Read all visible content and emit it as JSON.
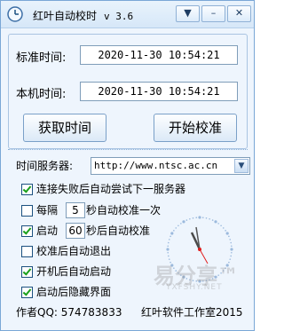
{
  "window": {
    "title": "红叶自动校时",
    "version": "v 3.6",
    "buttons": {
      "pin": "▼",
      "minimize": "–",
      "close": "✕"
    }
  },
  "standard_time": {
    "label": "标准时间:",
    "value": "2020-11-30   10:54:21"
  },
  "local_time": {
    "label": "本机时间:",
    "value": "2020-11-30   10:54:21"
  },
  "actions": {
    "fetch_label": "获取时间",
    "sync_label": "开始校准"
  },
  "server": {
    "label": "时间服务器:",
    "value": "http://www.ntsc.ac.cn"
  },
  "options": {
    "auto_next_server": {
      "label": "连接失败后自动尝试下一服务器",
      "checked": true
    },
    "interval": {
      "prefix": "每隔",
      "value": "5",
      "suffix": "秒自动校准一次",
      "checked": false
    },
    "on_start": {
      "prefix": "启动",
      "value": "60",
      "suffix": "秒后自动校准",
      "checked": true
    },
    "auto_exit": {
      "label": "校准后自动退出",
      "checked": false
    },
    "run_at_boot": {
      "label": "开机后自动启动",
      "checked": true
    },
    "hide_after_start": {
      "label": "启动后隐藏界面",
      "checked": true
    }
  },
  "footer": {
    "author": "作者QQ: 574783833",
    "studio": "红叶软件工作室2015"
  },
  "watermark": {
    "main": "易分享™",
    "sub": "YXFSHY.NET"
  },
  "colors": {
    "accent": "#1c5180",
    "clock_second_hand": "#e11b1b",
    "clock_ticks": "#9bb9dd"
  }
}
